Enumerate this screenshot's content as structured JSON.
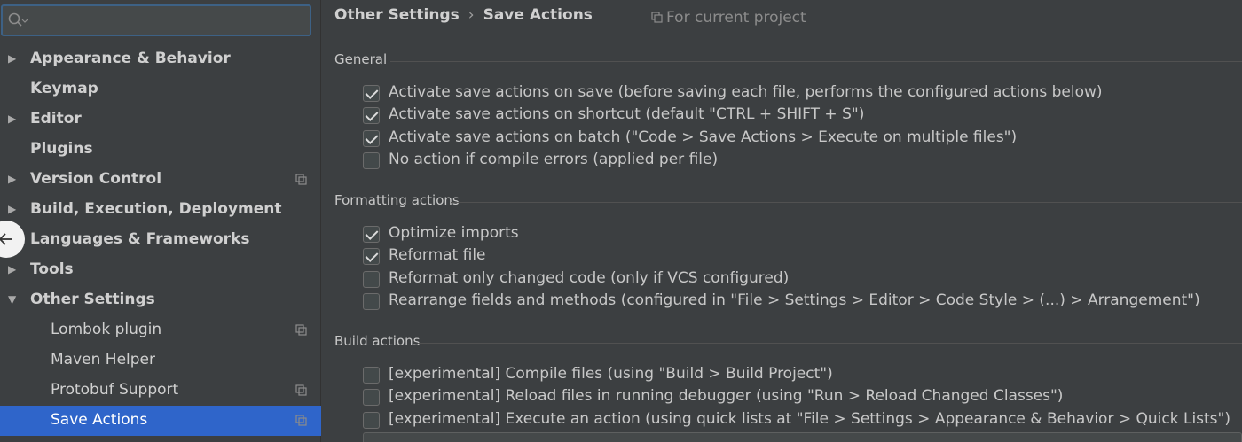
{
  "sidebar": {
    "search": {
      "value": ""
    },
    "items": [
      {
        "label": "Appearance & Behavior",
        "level": "top",
        "expandable": true,
        "expanded": false,
        "project": false,
        "selected": false
      },
      {
        "label": "Keymap",
        "level": "top",
        "expandable": false,
        "expanded": false,
        "project": false,
        "selected": false
      },
      {
        "label": "Editor",
        "level": "top",
        "expandable": true,
        "expanded": false,
        "project": false,
        "selected": false
      },
      {
        "label": "Plugins",
        "level": "top",
        "expandable": false,
        "expanded": false,
        "project": false,
        "selected": false
      },
      {
        "label": "Version Control",
        "level": "top",
        "expandable": true,
        "expanded": false,
        "project": true,
        "selected": false
      },
      {
        "label": "Build, Execution, Deployment",
        "level": "top",
        "expandable": true,
        "expanded": false,
        "project": false,
        "selected": false
      },
      {
        "label": "Languages & Frameworks",
        "level": "top",
        "expandable": true,
        "expanded": false,
        "project": false,
        "selected": false
      },
      {
        "label": "Tools",
        "level": "top",
        "expandable": true,
        "expanded": false,
        "project": false,
        "selected": false
      },
      {
        "label": "Other Settings",
        "level": "top",
        "expandable": true,
        "expanded": true,
        "project": false,
        "selected": false
      },
      {
        "label": "Lombok plugin",
        "level": "child",
        "expandable": false,
        "expanded": false,
        "project": true,
        "selected": false
      },
      {
        "label": "Maven Helper",
        "level": "child",
        "expandable": false,
        "expanded": false,
        "project": false,
        "selected": false
      },
      {
        "label": "Protobuf Support",
        "level": "child",
        "expandable": false,
        "expanded": false,
        "project": true,
        "selected": false
      },
      {
        "label": "Save Actions",
        "level": "child",
        "expandable": false,
        "expanded": false,
        "project": true,
        "selected": true
      }
    ]
  },
  "header": {
    "crumbs": [
      "Other Settings",
      "Save Actions"
    ],
    "separator": "›",
    "scope_label": "For current project"
  },
  "sections": [
    {
      "title": "General",
      "options": [
        {
          "label": "Activate save actions on save (before saving each file, performs the configured actions below)",
          "checked": true
        },
        {
          "label": "Activate save actions on shortcut (default \"CTRL + SHIFT + S\")",
          "checked": true
        },
        {
          "label": "Activate save actions on batch (\"Code > Save Actions > Execute on multiple files\")",
          "checked": true
        },
        {
          "label": "No action if compile errors (applied per file)",
          "checked": false
        }
      ]
    },
    {
      "title": "Formatting actions",
      "options": [
        {
          "label": "Optimize imports",
          "checked": true
        },
        {
          "label": "Reformat file",
          "checked": true
        },
        {
          "label": "Reformat only changed code (only if VCS configured)",
          "checked": false
        },
        {
          "label": "Rearrange fields and methods (configured in \"File > Settings > Editor > Code Style > (...) > Arrangement\")",
          "checked": false
        }
      ]
    },
    {
      "title": "Build actions",
      "options": [
        {
          "label": "[experimental] Compile files (using \"Build > Build Project\")",
          "checked": false
        },
        {
          "label": "[experimental] Reload files in running debugger (using \"Run > Reload Changed Classes\")",
          "checked": false
        },
        {
          "label": "[experimental] Execute an action (using quick lists at \"File > Settings > Appearance & Behavior > Quick Lists\")",
          "checked": false
        }
      ]
    }
  ],
  "colors": {
    "background": "#3c3f41",
    "selection": "#2f65ca",
    "search_focus_border": "#3d6185",
    "text": "#c8c8c8"
  },
  "icons": [
    "search-icon",
    "chevron-down-icon",
    "expand-arrow-icon",
    "collapse-arrow-icon",
    "project-scope-icon",
    "checkmark-icon",
    "back-arrow-icon"
  ]
}
